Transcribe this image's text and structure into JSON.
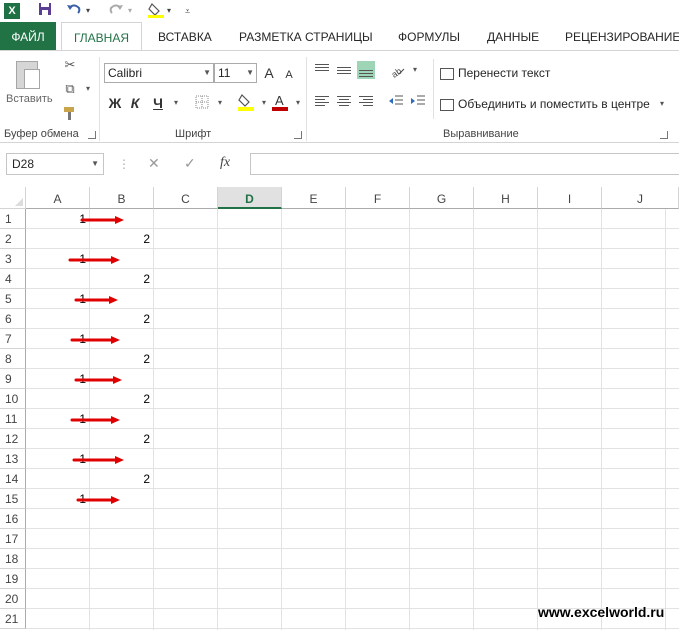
{
  "colors": {
    "accent": "#217346",
    "arrow": "#e00000",
    "font_color_bar": "#c00000",
    "highlight_bar": "#ffff00"
  },
  "qat": {
    "logo_icon": "excel-logo-icon",
    "save_icon": "save-icon",
    "undo_icon": "undo-icon",
    "redo_icon": "redo-icon",
    "fill_icon": "fill-color-icon",
    "customize_icon": "customize-qat-icon"
  },
  "tabs": [
    {
      "label": "ФАЙЛ"
    },
    {
      "label": "ГЛАВНАЯ"
    },
    {
      "label": "ВСТАВКА"
    },
    {
      "label": "РАЗМЕТКА СТРАНИЦЫ"
    },
    {
      "label": "ФОРМУЛЫ"
    },
    {
      "label": "ДАННЫЕ"
    },
    {
      "label": "РЕЦЕНЗИРОВАНИЕ"
    }
  ],
  "ribbon": {
    "clipboard": {
      "label": "Буфер обмена",
      "paste": "Вставить"
    },
    "font": {
      "label": "Шрифт",
      "name": "Calibri",
      "size": "11",
      "bold": "Ж",
      "italic": "К",
      "underline": "Ч",
      "grow": "A",
      "shrink": "A"
    },
    "alignment": {
      "label": "Выравнивание",
      "wrap": "Перенести текст",
      "merge": "Объединить и поместить в центре"
    }
  },
  "formula_bar": {
    "name_box": "D28",
    "cancel": "✕",
    "enter": "✓",
    "fx": "fx",
    "formula": ""
  },
  "grid": {
    "columns": [
      "A",
      "B",
      "C",
      "D",
      "E",
      "F",
      "G",
      "H",
      "I",
      "J"
    ],
    "selected_column": "D",
    "rows": [
      "1",
      "2",
      "3",
      "4",
      "5",
      "6",
      "7",
      "8",
      "9",
      "10",
      "11",
      "12",
      "13",
      "14",
      "15",
      "16",
      "17",
      "18",
      "19",
      "20",
      "21"
    ],
    "cells": [
      {
        "ref": "A1",
        "value": "1"
      },
      {
        "ref": "B2",
        "value": "2"
      },
      {
        "ref": "A3",
        "value": "1"
      },
      {
        "ref": "B4",
        "value": "2"
      },
      {
        "ref": "A5",
        "value": "1"
      },
      {
        "ref": "B6",
        "value": "2"
      },
      {
        "ref": "A7",
        "value": "1"
      },
      {
        "ref": "B8",
        "value": "2"
      },
      {
        "ref": "A9",
        "value": "1"
      },
      {
        "ref": "B10",
        "value": "2"
      },
      {
        "ref": "A11",
        "value": "1"
      },
      {
        "ref": "B12",
        "value": "2"
      },
      {
        "ref": "A13",
        "value": "1"
      },
      {
        "ref": "B14",
        "value": "2"
      },
      {
        "ref": "A15",
        "value": "1"
      }
    ],
    "arrow_rows": [
      "1",
      "3",
      "5",
      "7",
      "9",
      "11",
      "13",
      "15"
    ]
  },
  "watermark": "www.excelworld.ru"
}
